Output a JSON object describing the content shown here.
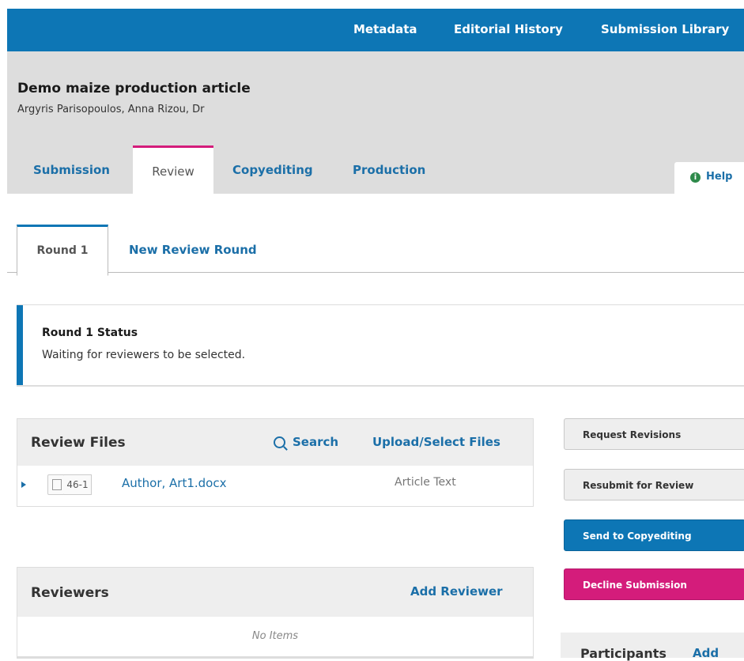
{
  "topnav": {
    "links": [
      "Metadata",
      "Editorial History",
      "Submission Library"
    ]
  },
  "submission": {
    "title": "Demo maize production article",
    "authors": "Argyris Parisopoulos, Anna Rizou, Dr"
  },
  "stage_tabs": {
    "submission": "Submission",
    "review": "Review",
    "copyediting": "Copyediting",
    "production": "Production",
    "active": "Review"
  },
  "help": {
    "icon": "info-icon",
    "label": "Help"
  },
  "round_tabs": {
    "round1": "Round 1",
    "new_round": "New Review Round"
  },
  "status": {
    "title": "Round 1 Status",
    "text": "Waiting for reviewers to be selected."
  },
  "review_files": {
    "title": "Review Files",
    "search_label": "Search",
    "upload_label": "Upload/Select Files",
    "files": [
      {
        "id": "46-1",
        "name": "Author, Art1.docx",
        "type": "Article Text"
      }
    ]
  },
  "reviewers": {
    "title": "Reviewers",
    "add_label": "Add Reviewer",
    "empty_text": "No Items"
  },
  "actions": {
    "request_revisions": "Request Revisions",
    "resubmit": "Resubmit for Review",
    "send_copyediting": "Send to Copyediting",
    "decline": "Decline Submission"
  },
  "participants": {
    "title": "Participants",
    "add_label": "Add"
  },
  "colors": {
    "brand_blue": "#0d76b5",
    "accent_pink": "#d41c7b",
    "link_blue": "#1b6fa8"
  }
}
